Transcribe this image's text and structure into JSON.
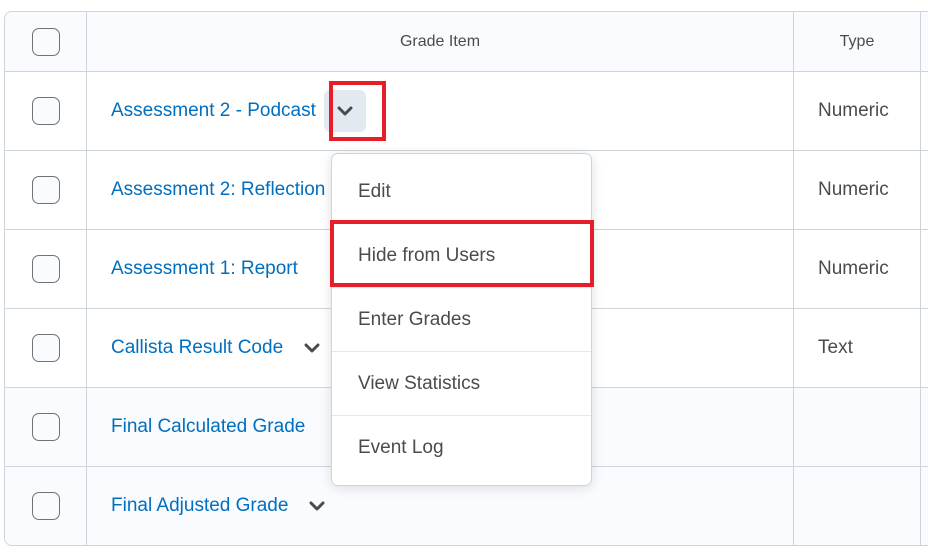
{
  "table": {
    "headers": {
      "grade_item": "Grade Item",
      "type": "Type"
    },
    "rows": [
      {
        "name": "Assessment 2 - Podcast",
        "type": "Numeric",
        "has_menu": true,
        "menu_open": true
      },
      {
        "name": "Assessment 2: Reflection",
        "type": "Numeric",
        "has_menu": false
      },
      {
        "name": "Assessment 1: Report",
        "type": "Numeric",
        "has_menu": false
      },
      {
        "name": "Callista Result Code",
        "type": "Text",
        "has_menu": true
      },
      {
        "name": "Final Calculated Grade",
        "type": "",
        "has_menu": false
      },
      {
        "name": "Final Adjusted Grade",
        "type": "",
        "has_menu": true
      }
    ]
  },
  "context_menu": {
    "items": [
      "Edit",
      "Hide from Users",
      "Enter Grades",
      "View Statistics",
      "Event Log"
    ],
    "highlighted": "Hide from Users"
  },
  "colors": {
    "link": "#006fbf",
    "highlight": "#e61e2a",
    "border": "#cdd5dc"
  }
}
